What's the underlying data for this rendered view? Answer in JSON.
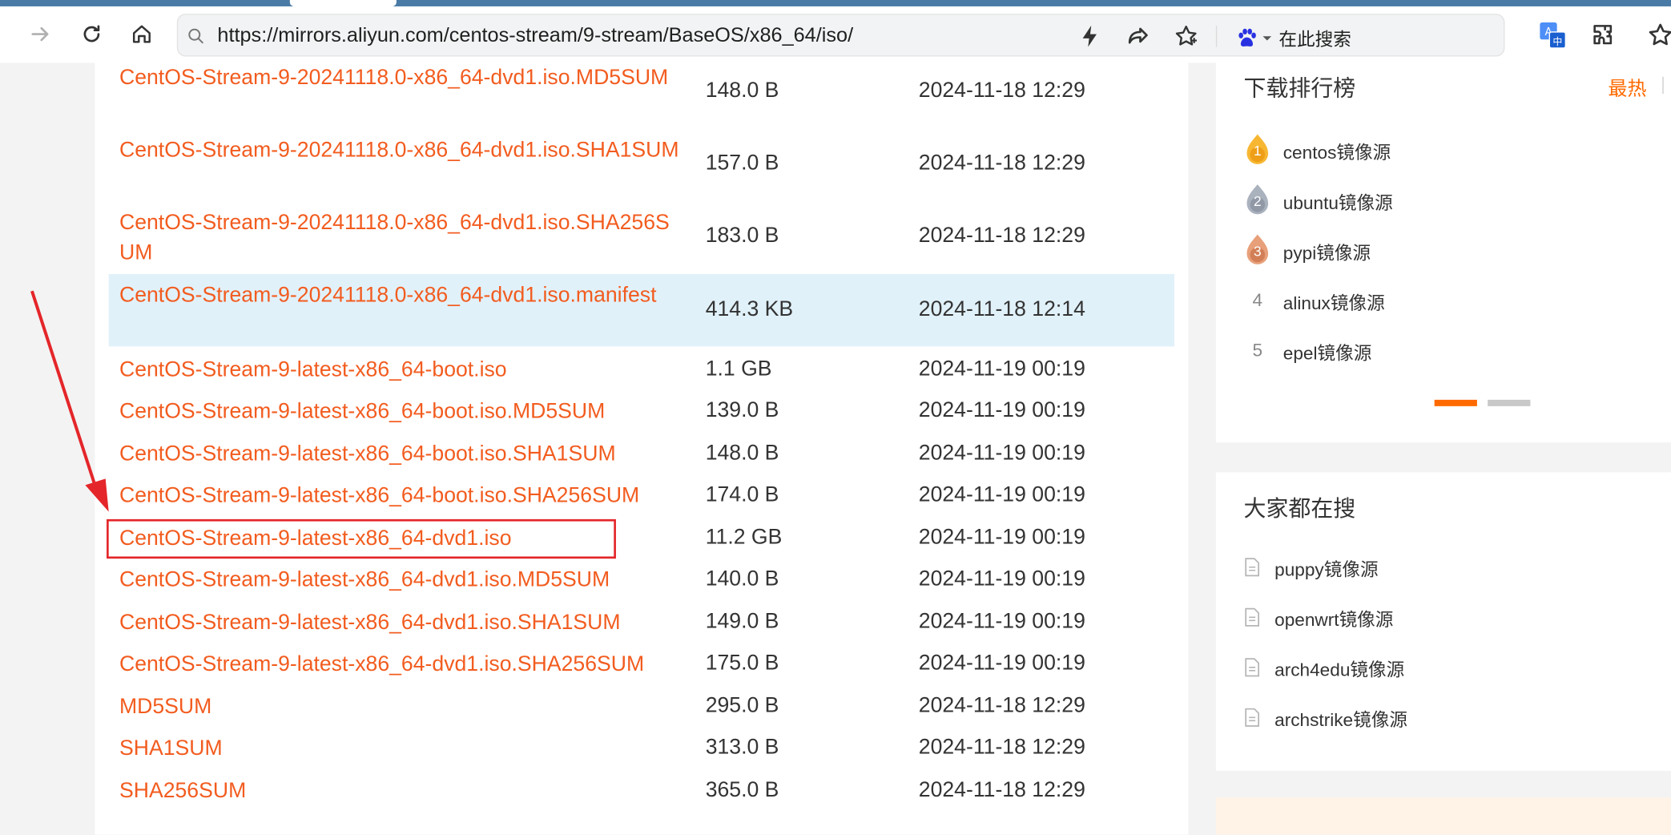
{
  "browser": {
    "url": "https://mirrors.aliyun.com/centos-stream/9-stream/BaseOS/x86_64/iso/",
    "search_engine_label": "在此搜索",
    "icons": [
      "forward-icon",
      "reload-icon",
      "home-icon",
      "search-icon",
      "lightning-icon",
      "share-icon",
      "star-icon",
      "baidu-paw-icon",
      "translate-icon",
      "extensions-icon",
      "favorites-icon"
    ]
  },
  "files": [
    {
      "name": "CentOS-Stream-9-20241118.0-x86_64-dvd1.iso.MD5SUM",
      "size": "148.0 B",
      "date": "2024-11-18 12:29"
    },
    {
      "name": "CentOS-Stream-9-20241118.0-x86_64-dvd1.iso.SHA1SUM",
      "size": "157.0 B",
      "date": "2024-11-18 12:29"
    },
    {
      "name": "CentOS-Stream-9-20241118.0-x86_64-dvd1.iso.SHA256SUM",
      "size": "183.0 B",
      "date": "2024-11-18 12:29"
    },
    {
      "name": "CentOS-Stream-9-20241118.0-x86_64-dvd1.iso.manifest",
      "size": "414.3 KB",
      "date": "2024-11-18 12:14",
      "hovered": true
    },
    {
      "name": "CentOS-Stream-9-latest-x86_64-boot.iso",
      "size": "1.1 GB",
      "date": "2024-11-19 00:19"
    },
    {
      "name": "CentOS-Stream-9-latest-x86_64-boot.iso.MD5SUM",
      "size": "139.0 B",
      "date": "2024-11-19 00:19"
    },
    {
      "name": "CentOS-Stream-9-latest-x86_64-boot.iso.SHA1SUM",
      "size": "148.0 B",
      "date": "2024-11-19 00:19"
    },
    {
      "name": "CentOS-Stream-9-latest-x86_64-boot.iso.SHA256SUM",
      "size": "174.0 B",
      "date": "2024-11-19 00:19"
    },
    {
      "name": "CentOS-Stream-9-latest-x86_64-dvd1.iso",
      "size": "11.2 GB",
      "date": "2024-11-19 00:19",
      "annotated": true
    },
    {
      "name": "CentOS-Stream-9-latest-x86_64-dvd1.iso.MD5SUM",
      "size": "140.0 B",
      "date": "2024-11-19 00:19"
    },
    {
      "name": "CentOS-Stream-9-latest-x86_64-dvd1.iso.SHA1SUM",
      "size": "149.0 B",
      "date": "2024-11-19 00:19"
    },
    {
      "name": "CentOS-Stream-9-latest-x86_64-dvd1.iso.SHA256SUM",
      "size": "175.0 B",
      "date": "2024-11-19 00:19"
    },
    {
      "name": "MD5SUM",
      "size": "295.0 B",
      "date": "2024-11-18 12:29"
    },
    {
      "name": "SHA1SUM",
      "size": "313.0 B",
      "date": "2024-11-18 12:29"
    },
    {
      "name": "SHA256SUM",
      "size": "365.0 B",
      "date": "2024-11-18 12:29"
    }
  ],
  "sidebar": {
    "ranking": {
      "title": "下载排行榜",
      "more_label": "最热",
      "items": [
        {
          "rank": "1",
          "label": "centos镜像源",
          "medal": "gold"
        },
        {
          "rank": "2",
          "label": "ubuntu镜像源",
          "medal": "silver"
        },
        {
          "rank": "3",
          "label": "pypi镜像源",
          "medal": "bronze"
        },
        {
          "rank": "4",
          "label": "alinux镜像源"
        },
        {
          "rank": "5",
          "label": "epel镜像源"
        }
      ],
      "active_page": 1,
      "page_count": 2
    },
    "popular": {
      "title": "大家都在搜",
      "items": [
        "puppy镜像源",
        "openwrt镜像源",
        "arch4edu镜像源",
        "archstrike镜像源"
      ]
    }
  },
  "colors": {
    "link": "#f25c1f",
    "accent": "#ff6a00",
    "highlight_row": "#e1f1fa",
    "annotation": "#e4262a",
    "tab_bar": "#4a7ba6"
  }
}
